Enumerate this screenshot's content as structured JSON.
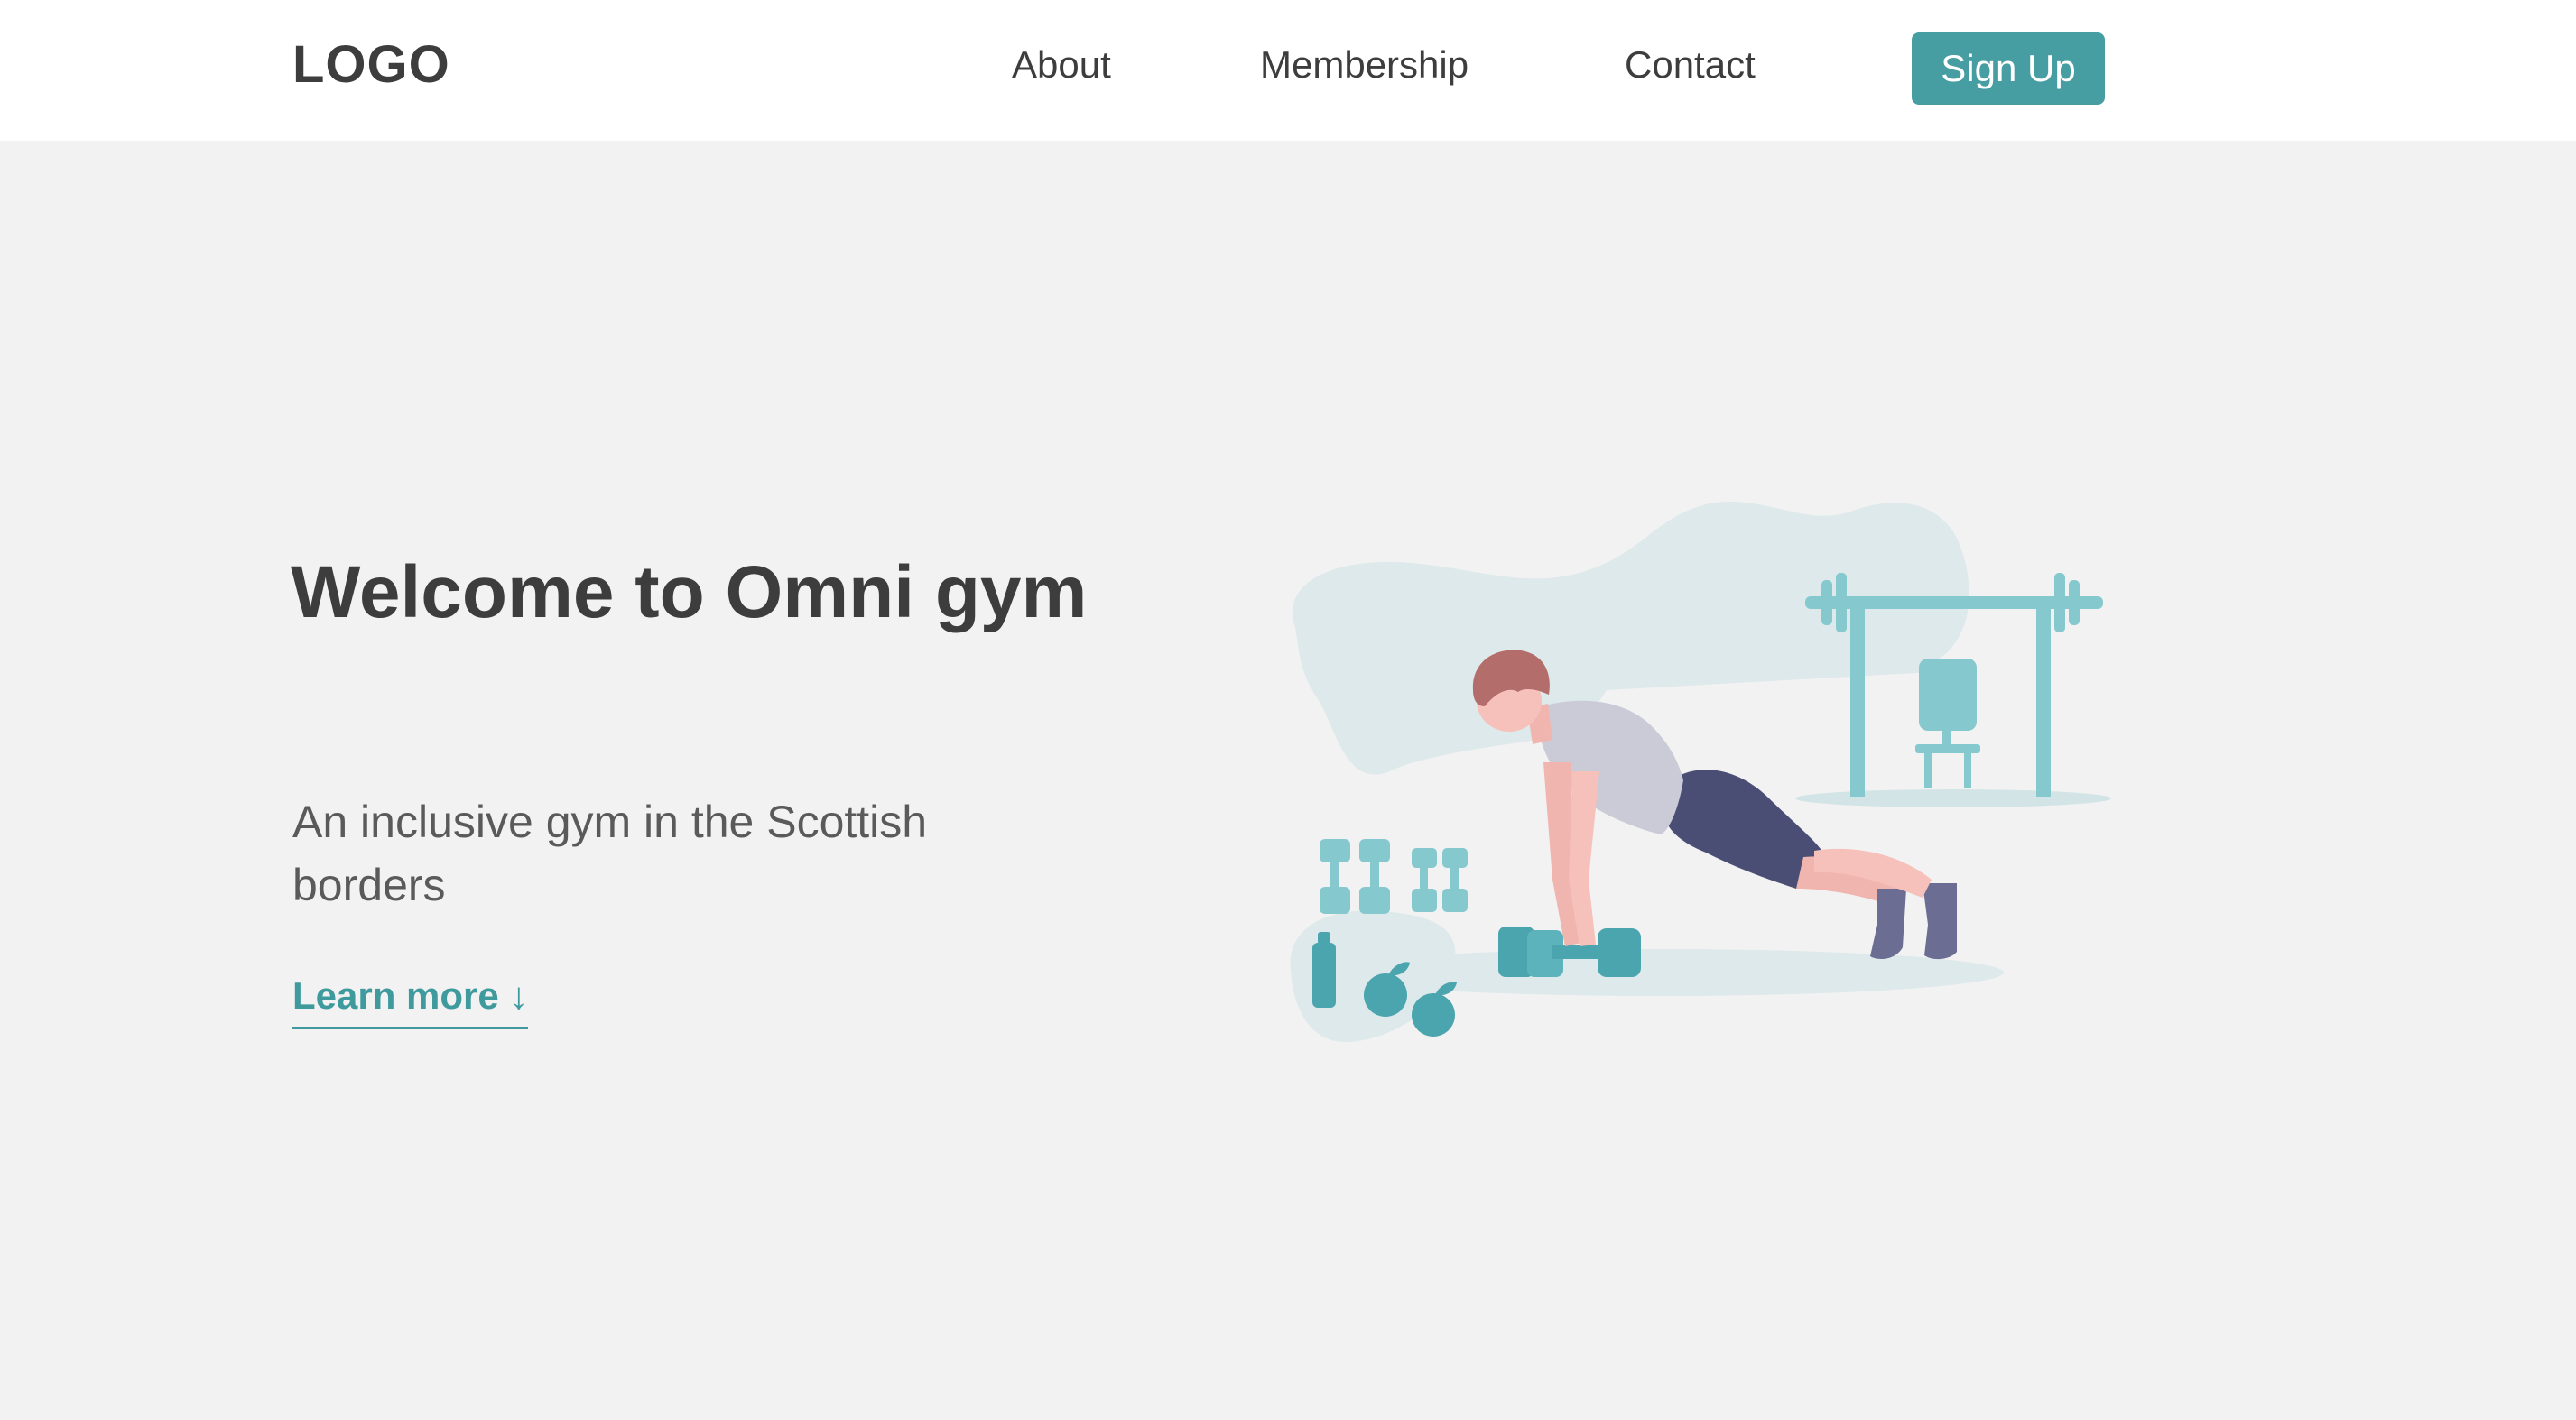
{
  "header": {
    "logo": "LOGO",
    "nav": [
      {
        "label": "About"
      },
      {
        "label": "Membership"
      },
      {
        "label": "Contact"
      }
    ],
    "signup_label": "Sign Up"
  },
  "hero": {
    "title": "Welcome to Omni gym",
    "subtitle": "An inclusive gym in the Scottish borders",
    "learn_more": "Learn more ↓"
  },
  "colors": {
    "accent": "#479ea2",
    "background": "#f2f2f2",
    "header_bg": "#ffffff",
    "text": "#3d3d3d"
  },
  "illustration": {
    "icon": "person-doing-pushups-illustration"
  }
}
